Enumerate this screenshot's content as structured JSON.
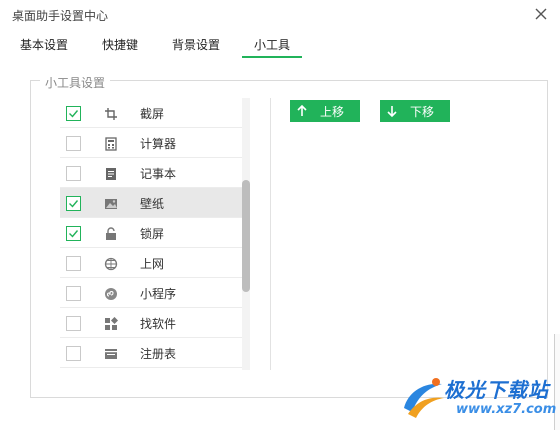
{
  "window": {
    "title": "桌面助手设置中心"
  },
  "tabs": [
    {
      "label": "基本设置",
      "active": false
    },
    {
      "label": "快捷键",
      "active": false
    },
    {
      "label": "背景设置",
      "active": false
    },
    {
      "label": "小工具",
      "active": true
    }
  ],
  "group": {
    "legend": "小工具设置"
  },
  "tools": [
    {
      "label": "截屏",
      "checked": true,
      "icon": "crop-icon",
      "highlighted": false
    },
    {
      "label": "计算器",
      "checked": false,
      "icon": "calculator-icon",
      "highlighted": false
    },
    {
      "label": "记事本",
      "checked": false,
      "icon": "notepad-icon",
      "highlighted": false
    },
    {
      "label": "壁纸",
      "checked": true,
      "icon": "image-icon",
      "highlighted": true
    },
    {
      "label": "锁屏",
      "checked": true,
      "icon": "lock-icon",
      "highlighted": false
    },
    {
      "label": "上网",
      "checked": false,
      "icon": "globe-icon",
      "highlighted": false
    },
    {
      "label": "小程序",
      "checked": false,
      "icon": "mini-program-icon",
      "highlighted": false
    },
    {
      "label": "找软件",
      "checked": false,
      "icon": "apps-icon",
      "highlighted": false
    },
    {
      "label": "注册表",
      "checked": false,
      "icon": "registry-icon",
      "highlighted": false
    },
    {
      "label": "",
      "checked": false,
      "icon": "list-icon",
      "highlighted": false
    }
  ],
  "actions": {
    "move_up": "上移",
    "move_down": "下移"
  },
  "watermark": {
    "name": "极光下载站",
    "url": "www.xz7.com"
  },
  "colors": {
    "accent": "#21b35a",
    "watermark_blue": "#1d6fd1"
  }
}
